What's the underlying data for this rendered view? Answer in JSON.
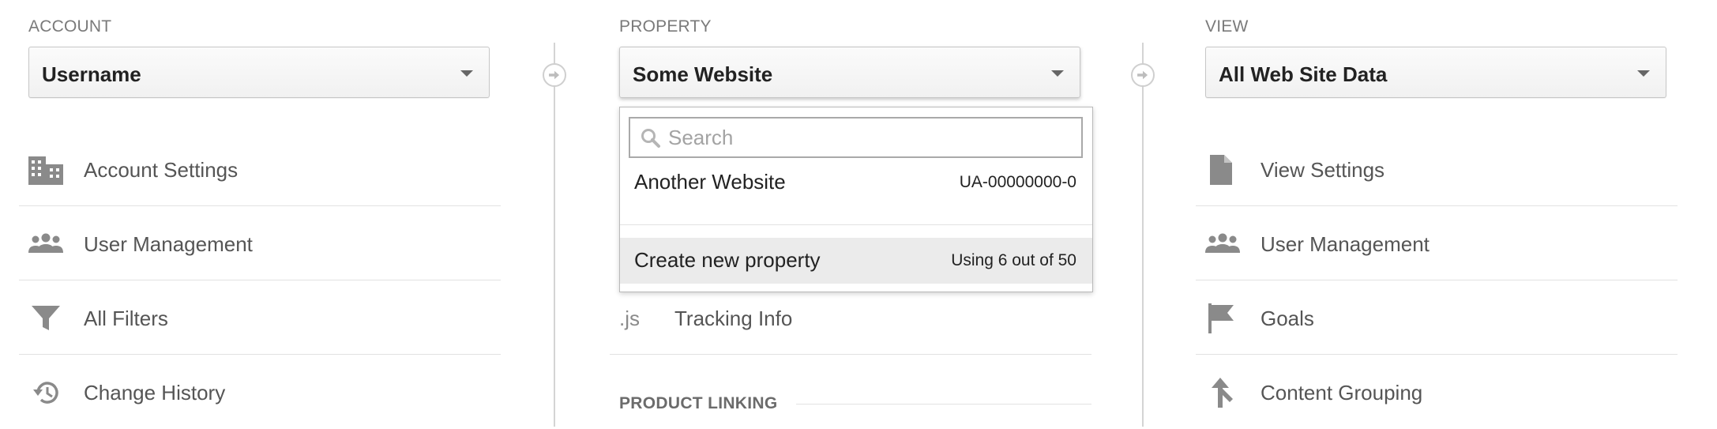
{
  "account": {
    "header": "ACCOUNT",
    "selected": "Username",
    "items": [
      {
        "label": "Account Settings",
        "icon": "building-icon"
      },
      {
        "label": "User Management",
        "icon": "users-icon"
      },
      {
        "label": "All Filters",
        "icon": "filter-icon"
      },
      {
        "label": "Change History",
        "icon": "history-icon"
      }
    ]
  },
  "property": {
    "header": "PROPERTY",
    "selected": "Some Website",
    "items": [
      {
        "label": "Tracking Info",
        "icon": "js-icon"
      }
    ],
    "section_heading": "PRODUCT LINKING",
    "dropdown": {
      "search_placeholder": "Search",
      "search_value": "",
      "options": [
        {
          "name": "Another Website",
          "id": "UA-00000000-0"
        }
      ],
      "create": {
        "label": "Create new property",
        "usage": "Using 6 out of 50"
      }
    }
  },
  "view": {
    "header": "VIEW",
    "selected": "All Web Site Data",
    "items": [
      {
        "label": "View Settings",
        "icon": "document-icon"
      },
      {
        "label": "User Management",
        "icon": "users-icon"
      },
      {
        "label": "Goals",
        "icon": "flag-icon"
      },
      {
        "label": "Content Grouping",
        "icon": "content-grouping-icon"
      }
    ]
  },
  "colors": {
    "icon_gray": "#8a8a8a",
    "highlight_row": "#ebebeb",
    "divider": "#e2e2e2"
  }
}
